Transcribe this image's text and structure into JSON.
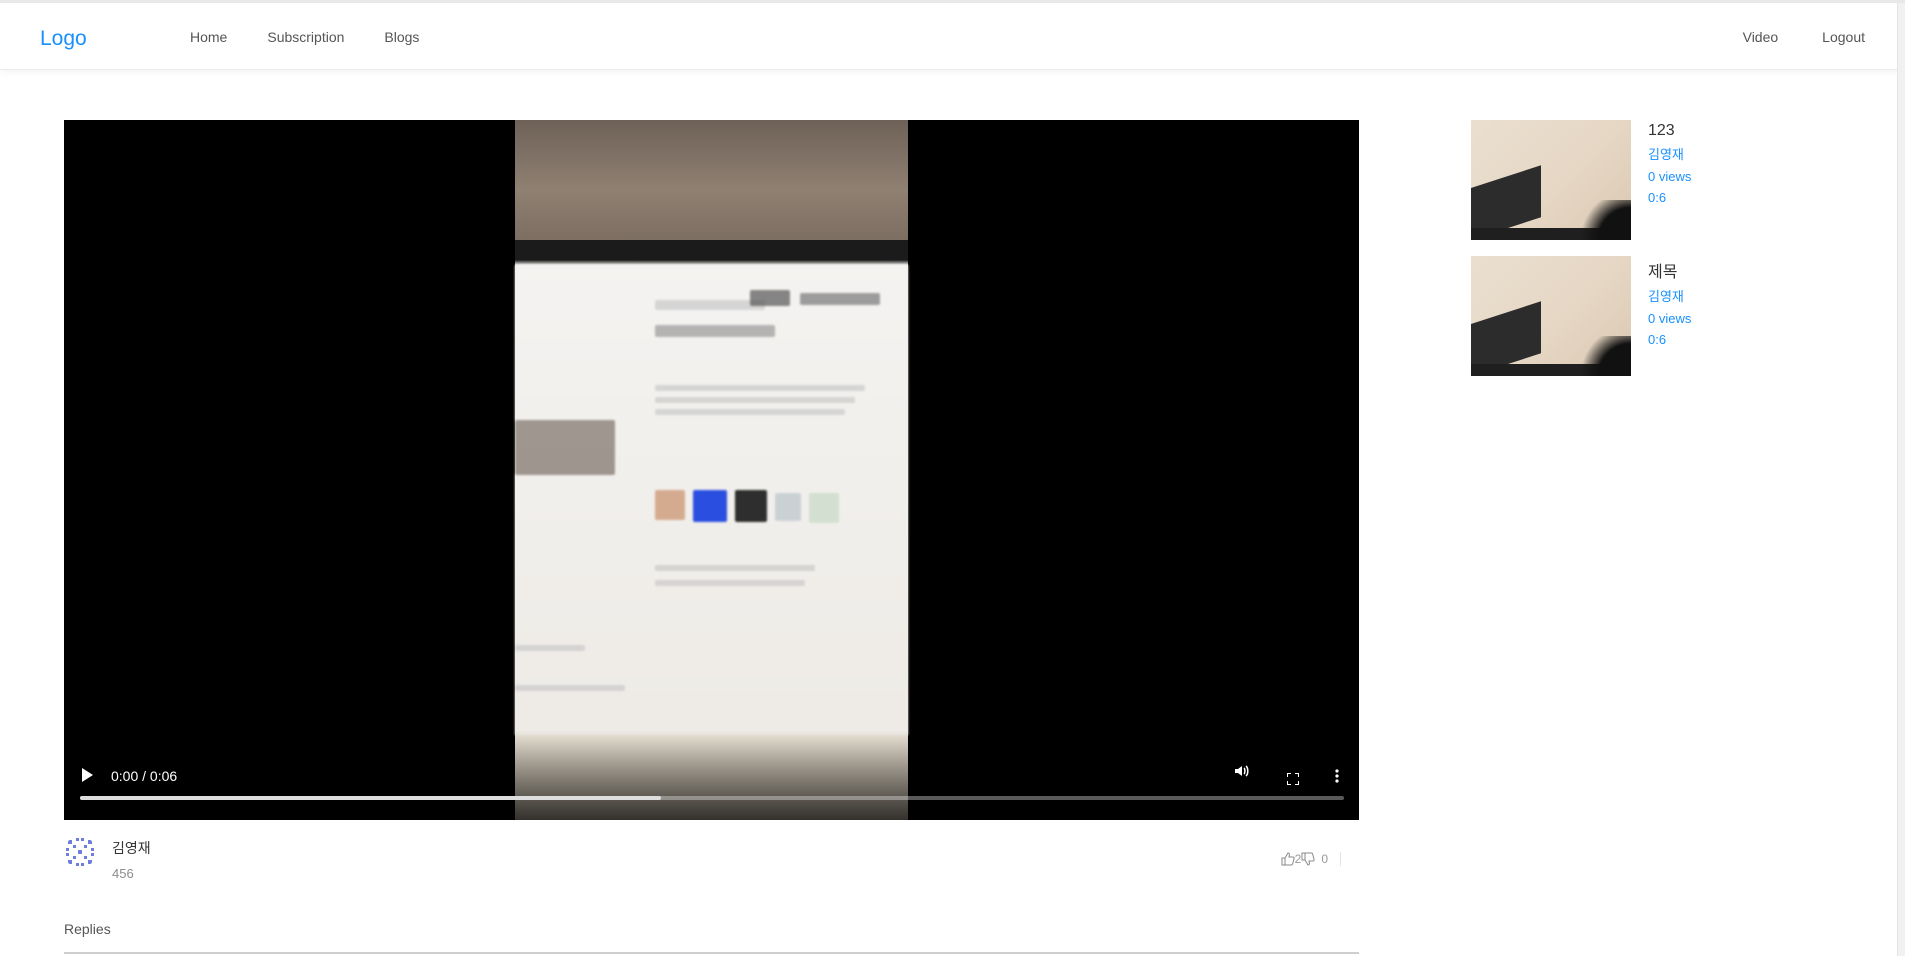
{
  "header": {
    "logo": "Logo",
    "nav_left": [
      "Home",
      "Subscription",
      "Blogs"
    ],
    "nav_right": [
      "Video",
      "Logout"
    ]
  },
  "player": {
    "time": "0:00 / 0:06",
    "progress": 0.46
  },
  "video": {
    "author": "김영재",
    "description": "456",
    "likes": "2",
    "dislikes": "0"
  },
  "replies": {
    "label": "Replies"
  },
  "sidebar": {
    "items": [
      {
        "title": "123",
        "author": "김영재",
        "views": "0 views",
        "duration": "0:6"
      },
      {
        "title": "제목",
        "author": "김영재",
        "views": "0 views",
        "duration": "0:6"
      }
    ]
  },
  "colors": {
    "accent": "#1890ff",
    "muted": "#8c8c8c"
  }
}
